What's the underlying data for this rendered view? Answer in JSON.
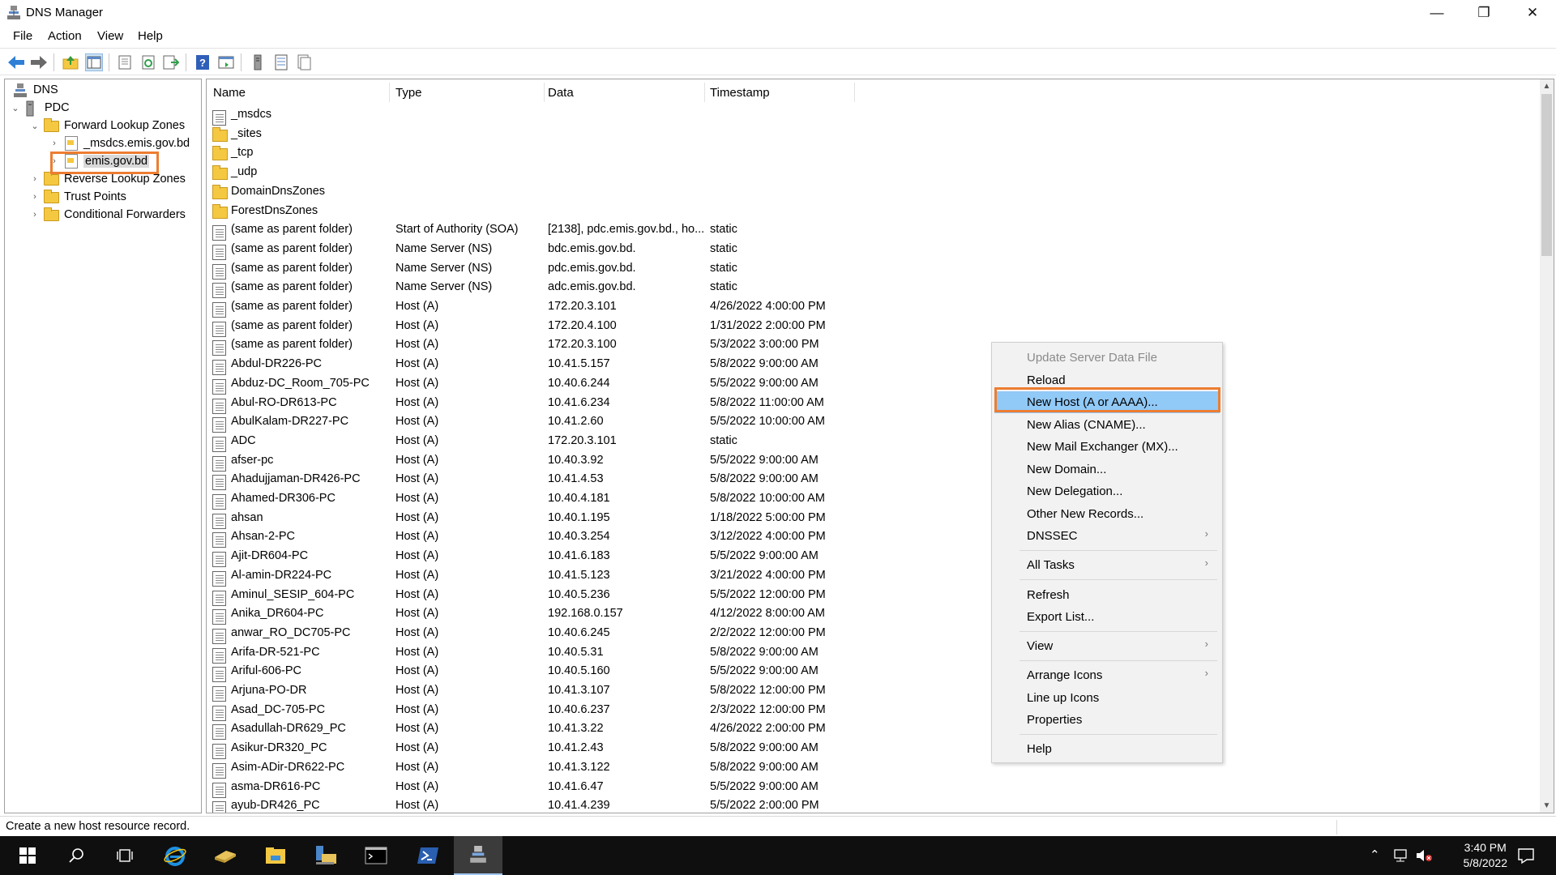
{
  "window": {
    "title": "DNS Manager",
    "minimize": "—",
    "restore": "❐",
    "close": "✕"
  },
  "menu": [
    "File",
    "Action",
    "View",
    "Help"
  ],
  "tree": {
    "root": "DNS",
    "server": "PDC",
    "forward_zones": "Forward Lookup Zones",
    "msdcs_zone": "_msdcs.emis.gov.bd",
    "selected_zone": "emis.gov.bd",
    "reverse_zones": "Reverse Lookup Zones",
    "trust_points": "Trust Points",
    "conditional_forwarders": "Conditional Forwarders"
  },
  "columns": {
    "name": "Name",
    "type": "Type",
    "data": "Data",
    "timestamp": "Timestamp"
  },
  "records": [
    {
      "icon": "zone-doc",
      "name": "_msdcs",
      "type": "",
      "data": "",
      "timestamp": ""
    },
    {
      "icon": "folder",
      "name": "_sites",
      "type": "",
      "data": "",
      "timestamp": ""
    },
    {
      "icon": "folder",
      "name": "_tcp",
      "type": "",
      "data": "",
      "timestamp": ""
    },
    {
      "icon": "folder",
      "name": "_udp",
      "type": "",
      "data": "",
      "timestamp": ""
    },
    {
      "icon": "folder",
      "name": "DomainDnsZones",
      "type": "",
      "data": "",
      "timestamp": ""
    },
    {
      "icon": "folder",
      "name": "ForestDnsZones",
      "type": "",
      "data": "",
      "timestamp": ""
    },
    {
      "icon": "record",
      "name": "(same as parent folder)",
      "type": "Start of Authority (SOA)",
      "data": "[2138], pdc.emis.gov.bd., ho...",
      "timestamp": "static"
    },
    {
      "icon": "record",
      "name": "(same as parent folder)",
      "type": "Name Server (NS)",
      "data": "bdc.emis.gov.bd.",
      "timestamp": "static"
    },
    {
      "icon": "record",
      "name": "(same as parent folder)",
      "type": "Name Server (NS)",
      "data": "pdc.emis.gov.bd.",
      "timestamp": "static"
    },
    {
      "icon": "record",
      "name": "(same as parent folder)",
      "type": "Name Server (NS)",
      "data": "adc.emis.gov.bd.",
      "timestamp": "static"
    },
    {
      "icon": "record",
      "name": "(same as parent folder)",
      "type": "Host (A)",
      "data": "172.20.3.101",
      "timestamp": "4/26/2022 4:00:00 PM"
    },
    {
      "icon": "record",
      "name": "(same as parent folder)",
      "type": "Host (A)",
      "data": "172.20.4.100",
      "timestamp": "1/31/2022 2:00:00 PM"
    },
    {
      "icon": "record",
      "name": "(same as parent folder)",
      "type": "Host (A)",
      "data": "172.20.3.100",
      "timestamp": "5/3/2022 3:00:00 PM"
    },
    {
      "icon": "record",
      "name": "Abdul-DR226-PC",
      "type": "Host (A)",
      "data": "10.41.5.157",
      "timestamp": "5/8/2022 9:00:00 AM"
    },
    {
      "icon": "record",
      "name": "Abduz-DC_Room_705-PC",
      "type": "Host (A)",
      "data": "10.40.6.244",
      "timestamp": "5/5/2022 9:00:00 AM"
    },
    {
      "icon": "record",
      "name": "Abul-RO-DR613-PC",
      "type": "Host (A)",
      "data": "10.41.6.234",
      "timestamp": "5/8/2022 11:00:00 AM"
    },
    {
      "icon": "record",
      "name": "AbulKalam-DR227-PC",
      "type": "Host (A)",
      "data": "10.41.2.60",
      "timestamp": "5/5/2022 10:00:00 AM"
    },
    {
      "icon": "record",
      "name": "ADC",
      "type": "Host (A)",
      "data": "172.20.3.101",
      "timestamp": "static"
    },
    {
      "icon": "record",
      "name": "afser-pc",
      "type": "Host (A)",
      "data": "10.40.3.92",
      "timestamp": "5/5/2022 9:00:00 AM"
    },
    {
      "icon": "record",
      "name": "Ahadujjaman-DR426-PC",
      "type": "Host (A)",
      "data": "10.41.4.53",
      "timestamp": "5/8/2022 9:00:00 AM"
    },
    {
      "icon": "record",
      "name": "Ahamed-DR306-PC",
      "type": "Host (A)",
      "data": "10.40.4.181",
      "timestamp": "5/8/2022 10:00:00 AM"
    },
    {
      "icon": "record",
      "name": "ahsan",
      "type": "Host (A)",
      "data": "10.40.1.195",
      "timestamp": "1/18/2022 5:00:00 PM"
    },
    {
      "icon": "record",
      "name": "Ahsan-2-PC",
      "type": "Host (A)",
      "data": "10.40.3.254",
      "timestamp": "3/12/2022 4:00:00 PM"
    },
    {
      "icon": "record",
      "name": "Ajit-DR604-PC",
      "type": "Host (A)",
      "data": "10.41.6.183",
      "timestamp": "5/5/2022 9:00:00 AM"
    },
    {
      "icon": "record",
      "name": "Al-amin-DR224-PC",
      "type": "Host (A)",
      "data": "10.41.5.123",
      "timestamp": "3/21/2022 4:00:00 PM"
    },
    {
      "icon": "record",
      "name": "Aminul_SESIP_604-PC",
      "type": "Host (A)",
      "data": "10.40.5.236",
      "timestamp": "5/5/2022 12:00:00 PM"
    },
    {
      "icon": "record",
      "name": "Anika_DR604-PC",
      "type": "Host (A)",
      "data": "192.168.0.157",
      "timestamp": "4/12/2022 8:00:00 AM"
    },
    {
      "icon": "record",
      "name": "anwar_RO_DC705-PC",
      "type": "Host (A)",
      "data": "10.40.6.245",
      "timestamp": "2/2/2022 12:00:00 PM"
    },
    {
      "icon": "record",
      "name": "Arifa-DR-521-PC",
      "type": "Host (A)",
      "data": "10.40.5.31",
      "timestamp": "5/8/2022 9:00:00 AM"
    },
    {
      "icon": "record",
      "name": "Ariful-606-PC",
      "type": "Host (A)",
      "data": "10.40.5.160",
      "timestamp": "5/5/2022 9:00:00 AM"
    },
    {
      "icon": "record",
      "name": "Arjuna-PO-DR",
      "type": "Host (A)",
      "data": "10.41.3.107",
      "timestamp": "5/8/2022 12:00:00 PM"
    },
    {
      "icon": "record",
      "name": "Asad_DC-705-PC",
      "type": "Host (A)",
      "data": "10.40.6.237",
      "timestamp": "2/3/2022 12:00:00 PM"
    },
    {
      "icon": "record",
      "name": "Asadullah-DR629_PC",
      "type": "Host (A)",
      "data": "10.41.3.22",
      "timestamp": "4/26/2022 2:00:00 PM"
    },
    {
      "icon": "record",
      "name": "Asikur-DR320_PC",
      "type": "Host (A)",
      "data": "10.41.2.43",
      "timestamp": "5/8/2022 9:00:00 AM"
    },
    {
      "icon": "record",
      "name": "Asim-ADir-DR622-PC",
      "type": "Host (A)",
      "data": "10.41.3.122",
      "timestamp": "5/8/2022 9:00:00 AM"
    },
    {
      "icon": "record",
      "name": "asma-DR616-PC",
      "type": "Host (A)",
      "data": "10.41.6.47",
      "timestamp": "5/5/2022 9:00:00 AM"
    },
    {
      "icon": "record",
      "name": "ayub-DR426_PC",
      "type": "Host (A)",
      "data": "10.41.4.239",
      "timestamp": "5/5/2022 2:00:00 PM"
    }
  ],
  "context_menu": {
    "update_server_data_file": "Update Server Data File",
    "reload": "Reload",
    "new_host": "New Host (A or AAAA)...",
    "new_alias": "New Alias (CNAME)...",
    "new_mail_exchanger": "New Mail Exchanger (MX)...",
    "new_domain": "New Domain...",
    "new_delegation": "New Delegation...",
    "other_new_records": "Other New Records...",
    "dnssec": "DNSSEC",
    "all_tasks": "All Tasks",
    "refresh": "Refresh",
    "export_list": "Export List...",
    "view": "View",
    "arrange_icons": "Arrange Icons",
    "line_up_icons": "Line up Icons",
    "properties": "Properties",
    "help": "Help",
    "submenu_arrow": "›"
  },
  "status": "Create a new host resource record.",
  "taskbar": {
    "time": "3:40 PM",
    "date": "5/8/2022"
  },
  "colors": {
    "highlight_box": "#ed7d31",
    "menu_highlight": "#91c9f7",
    "taskbar_bg": "#0f0f0f"
  }
}
